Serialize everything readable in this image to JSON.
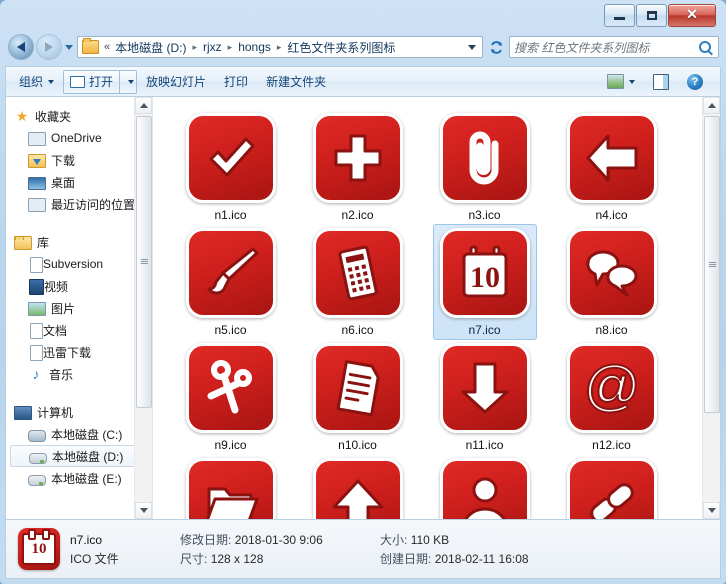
{
  "window": {
    "controls": {
      "minimize": "minimize-icon",
      "maximize": "maximize-icon",
      "close": "✕"
    }
  },
  "address": {
    "back_tooltip": "后退",
    "forward_tooltip": "前进",
    "chevrons": "«",
    "crumbs": [
      {
        "label": "本地磁盘 (D:)",
        "grey": false
      },
      {
        "label": "rjxz",
        "grey": false
      },
      {
        "label": "hongs",
        "grey": false
      },
      {
        "label": "红色文件夹系列图标",
        "grey": false
      }
    ],
    "separator": "▸",
    "refresh_label": "↺"
  },
  "search": {
    "placeholder": "搜索 红色文件夹系列图标",
    "value": ""
  },
  "toolbar": {
    "organize_label": "组织",
    "open_label": "打开",
    "slideshow_label": "放映幻灯片",
    "print_label": "打印",
    "new_folder_label": "新建文件夹",
    "help_label": "?"
  },
  "sidebar": {
    "groups": [
      {
        "header": {
          "label": "收藏夹",
          "icon": "star-icon",
          "icon_class": "i-star",
          "glyph": "★"
        },
        "items": [
          {
            "label": "OneDrive",
            "icon": "onedrive-icon",
            "icon_class": "i-recent"
          },
          {
            "label": "下载",
            "icon": "downloads-icon",
            "icon_class": "i-dl"
          },
          {
            "label": "桌面",
            "icon": "desktop-icon",
            "icon_class": "i-desk"
          },
          {
            "label": "最近访问的位置",
            "icon": "recent-places-icon",
            "icon_class": "i-recent"
          }
        ]
      },
      {
        "header": {
          "label": "库",
          "icon": "library-icon",
          "icon_class": "i-lib",
          "glyph": ""
        },
        "items": [
          {
            "label": "Subversion",
            "icon": "subversion-icon",
            "icon_class": "i-doc"
          },
          {
            "label": "视频",
            "icon": "videos-icon",
            "icon_class": "i-video"
          },
          {
            "label": "图片",
            "icon": "pictures-icon",
            "icon_class": "i-pic"
          },
          {
            "label": "文档",
            "icon": "documents-icon",
            "icon_class": "i-doc"
          },
          {
            "label": "迅雷下载",
            "icon": "thunder-download-icon",
            "icon_class": "i-doc"
          },
          {
            "label": "音乐",
            "icon": "music-icon",
            "icon_class": "i-music",
            "glyph": "♪"
          }
        ]
      },
      {
        "header": {
          "label": "计算机",
          "icon": "computer-icon",
          "icon_class": "i-comp",
          "glyph": ""
        },
        "items": [
          {
            "label": "本地磁盘 (C:)",
            "icon": "drive-c-icon",
            "icon_class": "i-diskc",
            "selected": false
          },
          {
            "label": "本地磁盘 (D:)",
            "icon": "drive-d-icon",
            "icon_class": "i-disk",
            "selected": true
          },
          {
            "label": "本地磁盘 (E:)",
            "icon": "drive-e-icon",
            "icon_class": "i-disk",
            "selected": false
          }
        ]
      }
    ]
  },
  "files": [
    {
      "name": "n1.ico",
      "icon": "checkmark-icon",
      "selected": false
    },
    {
      "name": "n2.ico",
      "icon": "plus-icon",
      "selected": false
    },
    {
      "name": "n3.ico",
      "icon": "paperclip-icon",
      "selected": false
    },
    {
      "name": "n4.ico",
      "icon": "arrow-left-icon",
      "selected": false
    },
    {
      "name": "n5.ico",
      "icon": "paintbrush-icon",
      "selected": false
    },
    {
      "name": "n6.ico",
      "icon": "calculator-icon",
      "selected": false
    },
    {
      "name": "n7.ico",
      "icon": "calendar-icon",
      "selected": true,
      "badge": "10"
    },
    {
      "name": "n8.ico",
      "icon": "chat-bubbles-icon",
      "selected": false
    },
    {
      "name": "n9.ico",
      "icon": "scissors-icon",
      "selected": false
    },
    {
      "name": "n10.ico",
      "icon": "document-icon",
      "selected": false
    },
    {
      "name": "n11.ico",
      "icon": "arrow-down-icon",
      "selected": false
    },
    {
      "name": "n12.ico",
      "icon": "at-sign-icon",
      "selected": false
    },
    {
      "name": "",
      "icon": "folder-open-icon",
      "selected": false
    },
    {
      "name": "",
      "icon": "upload-icon",
      "selected": false
    },
    {
      "name": "",
      "icon": "person-icon",
      "selected": false
    },
    {
      "name": "",
      "icon": "link-chain-icon",
      "selected": false
    }
  ],
  "status": {
    "icon": "calendar-icon",
    "badge": "10",
    "file_name": "n7.ico",
    "file_type": "ICO 文件",
    "modified_label": "修改日期:",
    "modified_value": "2018-01-30 9:06",
    "dimensions_label": "尺寸:",
    "dimensions_value": "128 x 128",
    "size_label": "大小:",
    "size_value": "110 KB",
    "created_label": "创建日期:",
    "created_value": "2018-02-11 16:08"
  },
  "colors": {
    "icon_red": "#d0201d",
    "icon_red_dark": "#a81512",
    "selection_blue": "#cde3f8",
    "chrome_blue": "#b6d4ee"
  }
}
